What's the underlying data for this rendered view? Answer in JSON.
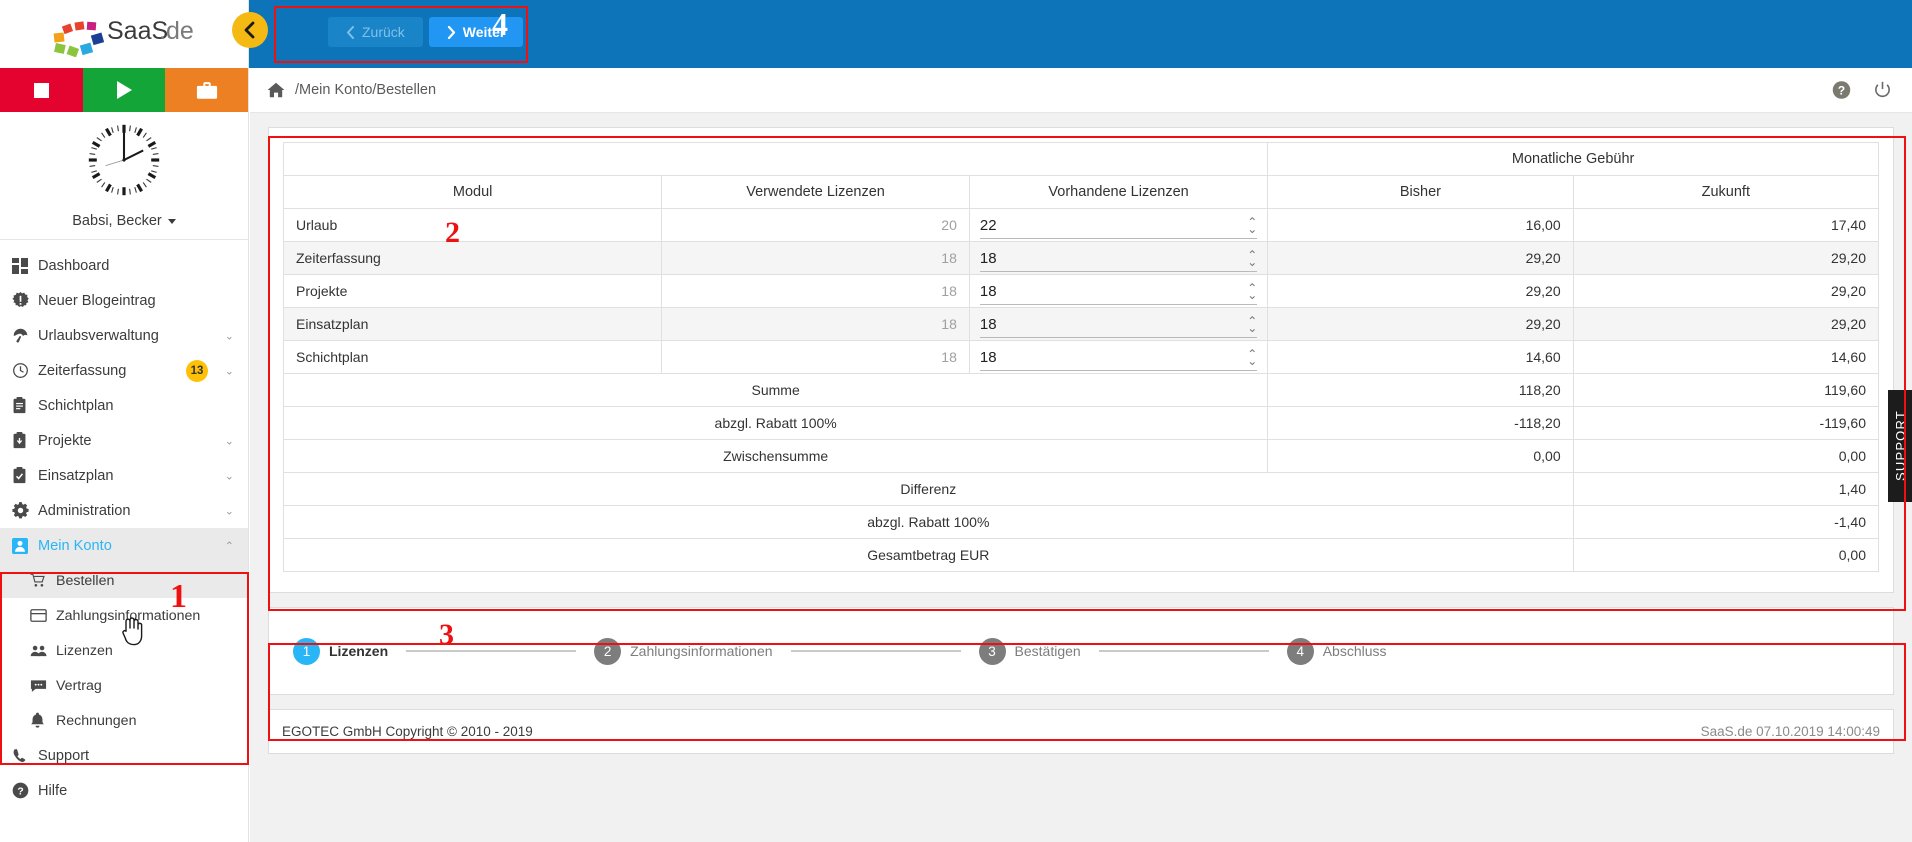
{
  "brand": {
    "name": "SaaS.de",
    "accent": "#0d74ba",
    "highlight": "#29b6f6",
    "marker_color": "#ee1111"
  },
  "sidebar": {
    "user": {
      "name": "Babsi, Becker",
      "caret_icon": "chevron-down-icon"
    },
    "quickbar": [
      {
        "name": "stop-button",
        "icon": "stop-icon",
        "color": "#e3032e"
      },
      {
        "name": "play-button",
        "icon": "play-icon",
        "color": "#13a538"
      },
      {
        "name": "briefcase-button",
        "icon": "briefcase-icon",
        "color": "#ec8022"
      }
    ],
    "items": [
      {
        "label": "Dashboard",
        "icon": "dashboard-icon",
        "expandable": false,
        "badge": ""
      },
      {
        "label": "Neuer Blogeintrag",
        "icon": "alert-icon",
        "expandable": false,
        "badge": ""
      },
      {
        "label": "Urlaubsverwaltung",
        "icon": "umbrella-icon",
        "expandable": true,
        "badge": ""
      },
      {
        "label": "Zeiterfassung",
        "icon": "clock-icon",
        "expandable": true,
        "badge": "13"
      },
      {
        "label": "Schichtplan",
        "icon": "clipboard-icon",
        "expandable": false,
        "badge": ""
      },
      {
        "label": "Projekte",
        "icon": "project-icon",
        "expandable": true,
        "badge": ""
      },
      {
        "label": "Einsatzplan",
        "icon": "checklist-icon",
        "expandable": true,
        "badge": ""
      },
      {
        "label": "Administration",
        "icon": "gear-icon",
        "expandable": true,
        "badge": ""
      },
      {
        "label": "Mein Konto",
        "icon": "user-icon",
        "expandable": true,
        "badge": "",
        "active": true
      }
    ],
    "subitems": [
      {
        "label": "Bestellen",
        "icon": "cart-icon",
        "active": true
      },
      {
        "label": "Zahlungsinformationen",
        "icon": "credit-card-icon",
        "active": false
      },
      {
        "label": "Lizenzen",
        "icon": "people-icon",
        "active": false
      },
      {
        "label": "Vertrag",
        "icon": "contract-icon",
        "active": false
      },
      {
        "label": "Rechnungen",
        "icon": "bell-icon",
        "active": false
      }
    ],
    "footer_items": [
      {
        "label": "Support",
        "icon": "phone-icon"
      },
      {
        "label": "Hilfe",
        "icon": "help-icon"
      }
    ]
  },
  "topbar": {
    "collapse_icon": "chevron-left-icon",
    "back_label": "Zurück",
    "next_label": "Weiter",
    "back_icon": "chevron-left-icon",
    "next_icon": "chevron-right-icon",
    "marker": "4"
  },
  "breadcrumb": {
    "home_icon": "home-icon",
    "path": "/Mein Konto/Bestellen",
    "help_icon": "help-circle-icon",
    "power_icon": "power-icon"
  },
  "table": {
    "marker": "2",
    "group_header": "Monatliche Gebühr",
    "columns": [
      "Modul",
      "Verwendete Lizenzen",
      "Vorhandene Lizenzen",
      "Bisher",
      "Zukunft"
    ],
    "rows": [
      {
        "modul": "Urlaub",
        "used": "20",
        "available": "22",
        "bisher": "16,00",
        "zukunft": "17,40"
      },
      {
        "modul": "Zeiterfassung",
        "used": "18",
        "available": "18",
        "bisher": "29,20",
        "zukunft": "29,20"
      },
      {
        "modul": "Projekte",
        "used": "18",
        "available": "18",
        "bisher": "29,20",
        "zukunft": "29,20"
      },
      {
        "modul": "Einsatzplan",
        "used": "18",
        "available": "18",
        "bisher": "29,20",
        "zukunft": "29,20"
      },
      {
        "modul": "Schichtplan",
        "used": "18",
        "available": "18",
        "bisher": "14,60",
        "zukunft": "14,60"
      }
    ],
    "summary": [
      {
        "label": "Summe",
        "bisher": "118,20",
        "zukunft": "119,60"
      },
      {
        "label": "abzgl. Rabatt 100%",
        "bisher": "-118,20",
        "zukunft": "-119,60"
      },
      {
        "label": "Zwischensumme",
        "bisher": "0,00",
        "zukunft": "0,00"
      }
    ],
    "totals": [
      {
        "label": "Differenz",
        "value": "1,40"
      },
      {
        "label": "abzgl. Rabatt 100%",
        "value": "-1,40"
      },
      {
        "label": "Gesamtbetrag EUR",
        "value": "0,00"
      }
    ]
  },
  "stepper": {
    "marker": "3",
    "steps": [
      {
        "num": "1",
        "label": "Lizenzen",
        "active": true
      },
      {
        "num": "2",
        "label": "Zahlungsinformationen",
        "active": false
      },
      {
        "num": "3",
        "label": "Bestätigen",
        "active": false
      },
      {
        "num": "4",
        "label": "Abschluss",
        "active": false
      }
    ]
  },
  "footer": {
    "copyright": "EGOTEC GmbH Copyright © 2010 - 2019",
    "status": "SaaS.de  07.10.2019 14:00:49"
  },
  "support_tab": {
    "label": "SUPPORT"
  },
  "markers": {
    "one": "1",
    "two": "2",
    "three": "3",
    "four": "4"
  }
}
